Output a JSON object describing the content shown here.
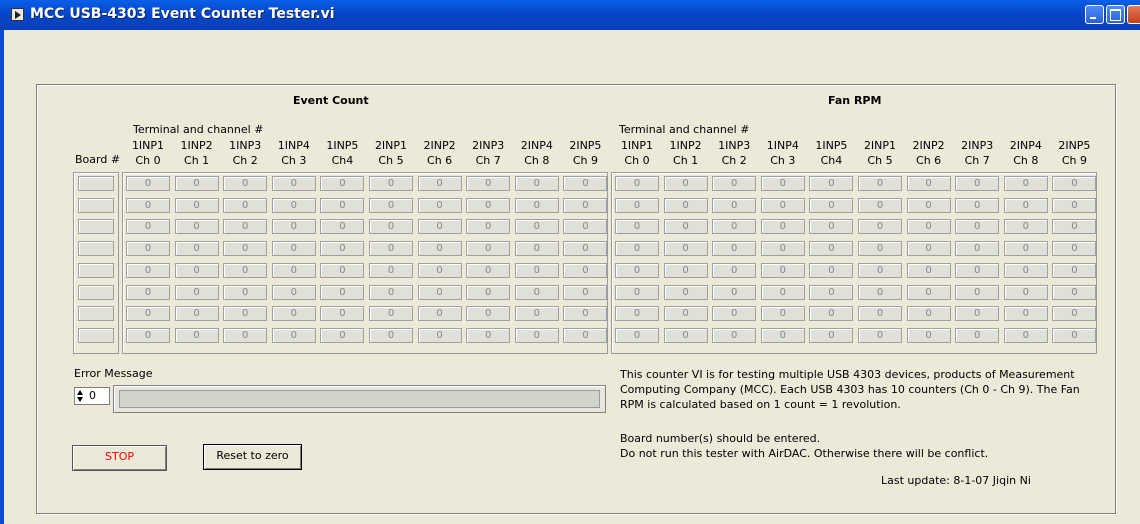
{
  "window": {
    "title": "MCC USB-4303 Event Counter Tester.vi"
  },
  "sections": {
    "event_title": "Event Count",
    "fan_title": "Fan RPM"
  },
  "board_label": "Board #",
  "terminal_label": "Terminal and channel #",
  "columns": [
    {
      "term": "1INP1",
      "ch": "Ch 0"
    },
    {
      "term": "1INP2",
      "ch": "Ch 1"
    },
    {
      "term": "1INP3",
      "ch": "Ch 2"
    },
    {
      "term": "1INP4",
      "ch": "Ch 3"
    },
    {
      "term": "1INP5",
      "ch": "Ch4"
    },
    {
      "term": "2INP1",
      "ch": "Ch 5"
    },
    {
      "term": "2INP2",
      "ch": "Ch 6"
    },
    {
      "term": "2INP3",
      "ch": "Ch 7"
    },
    {
      "term": "2INP4",
      "ch": "Ch 8"
    },
    {
      "term": "2INP5",
      "ch": "Ch 9"
    }
  ],
  "event_counts": [
    [
      "0",
      "0",
      "0",
      "0",
      "0",
      "0",
      "0",
      "0",
      "0",
      "0"
    ],
    [
      "0",
      "0",
      "0",
      "0",
      "0",
      "0",
      "0",
      "0",
      "0",
      "0"
    ],
    [
      "0",
      "0",
      "0",
      "0",
      "0",
      "0",
      "0",
      "0",
      "0",
      "0"
    ],
    [
      "0",
      "0",
      "0",
      "0",
      "0",
      "0",
      "0",
      "0",
      "0",
      "0"
    ],
    [
      "0",
      "0",
      "0",
      "0",
      "0",
      "0",
      "0",
      "0",
      "0",
      "0"
    ],
    [
      "0",
      "0",
      "0",
      "0",
      "0",
      "0",
      "0",
      "0",
      "0",
      "0"
    ],
    [
      "0",
      "0",
      "0",
      "0",
      "0",
      "0",
      "0",
      "0",
      "0",
      "0"
    ],
    [
      "0",
      "0",
      "0",
      "0",
      "0",
      "0",
      "0",
      "0",
      "0",
      "0"
    ]
  ],
  "fan_rpm": [
    [
      "0",
      "0",
      "0",
      "0",
      "0",
      "0",
      "0",
      "0",
      "0",
      "0"
    ],
    [
      "0",
      "0",
      "0",
      "0",
      "0",
      "0",
      "0",
      "0",
      "0",
      "0"
    ],
    [
      "0",
      "0",
      "0",
      "0",
      "0",
      "0",
      "0",
      "0",
      "0",
      "0"
    ],
    [
      "0",
      "0",
      "0",
      "0",
      "0",
      "0",
      "0",
      "0",
      "0",
      "0"
    ],
    [
      "0",
      "0",
      "0",
      "0",
      "0",
      "0",
      "0",
      "0",
      "0",
      "0"
    ],
    [
      "0",
      "0",
      "0",
      "0",
      "0",
      "0",
      "0",
      "0",
      "0",
      "0"
    ],
    [
      "0",
      "0",
      "0",
      "0",
      "0",
      "0",
      "0",
      "0",
      "0",
      "0"
    ],
    [
      "0",
      "0",
      "0",
      "0",
      "0",
      "0",
      "0",
      "0",
      "0",
      "0"
    ]
  ],
  "error": {
    "label": "Error Message",
    "index": "0",
    "text": ""
  },
  "buttons": {
    "stop": "STOP",
    "reset": "Reset to zero"
  },
  "description": "This counter VI is for testing multiple USB 4303 devices, products of Measurement Computing Company (MCC). Each USB 4303 has 10 counters (Ch 0 - Ch 9). The Fan RPM is calculated based on 1 count = 1 revolution.",
  "note_line1": "Board number(s) should be entered.",
  "note_line2": "Do not run this tester with AirDAC. Otherwise there will be conflict.",
  "last_update": "Last update: 8-1-07 Jiqin Ni",
  "colors": {
    "titlebar": "#0a5fe8",
    "stop_text": "#ff0000",
    "background": "#ece9d8"
  },
  "icons": [
    "labview-vi-icon",
    "minimize-icon",
    "maximize-icon",
    "close-icon",
    "spinner-arrows-icon"
  ]
}
